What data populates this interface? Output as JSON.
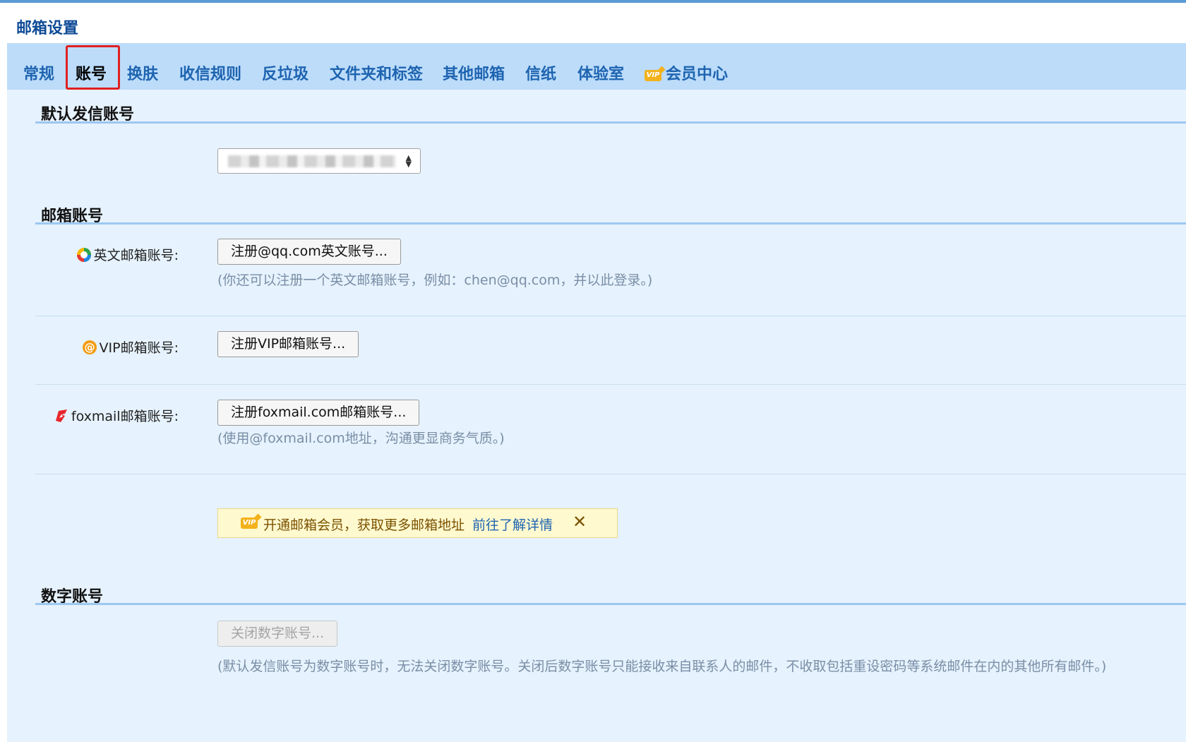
{
  "page_title": "邮箱设置",
  "tabs": [
    {
      "label": "常规"
    },
    {
      "label": "账号",
      "active": true
    },
    {
      "label": "换肤"
    },
    {
      "label": "收信规则"
    },
    {
      "label": "反垃圾"
    },
    {
      "label": "文件夹和标签"
    },
    {
      "label": "其他邮箱"
    },
    {
      "label": "信纸"
    },
    {
      "label": "体验室"
    },
    {
      "label": "会员中心",
      "icon": "vip-icon"
    }
  ],
  "vip_badge_text": "VIP",
  "default_account": {
    "title": "默认发信账号",
    "selected_value": ""
  },
  "mailbox_accounts": {
    "title": "邮箱账号",
    "english": {
      "icon": "qq-logo-icon",
      "label": "英文邮箱账号:",
      "button": "注册@qq.com英文账号...",
      "hint": "(你还可以注册一个英文邮箱账号，例如：chen@qq.com，并以此登录。)"
    },
    "vip": {
      "icon": "at-sign-icon",
      "label": "VIP邮箱账号:",
      "button": "注册VIP邮箱账号..."
    },
    "foxmail": {
      "icon": "foxmail-logo-icon",
      "label": "foxmail邮箱账号:",
      "button": "注册foxmail.com邮箱账号...",
      "hint": "(使用@foxmail.com地址，沟通更显商务气质。)"
    },
    "promo": {
      "message": "开通邮箱会员，获取更多邮箱地址",
      "link": "前往了解详情",
      "close": "✕"
    }
  },
  "number_account": {
    "title": "数字账号",
    "button": "关闭数字账号...",
    "button_disabled": true,
    "hint": "(默认发信账号为数字账号时，无法关闭数字账号。关闭后数字账号只能接收来自联系人的邮件，不收取包括重设密码等系统邮件在内的其他所有邮件。)"
  },
  "colors": {
    "tab_bar": "#bcdcfa",
    "content_bg": "#e6f2fd",
    "tab_text": "#1e64b0",
    "active_tab_outline": "#e02020",
    "hint_text": "#7a8ea6",
    "promo_bg": "#fff9cf"
  }
}
